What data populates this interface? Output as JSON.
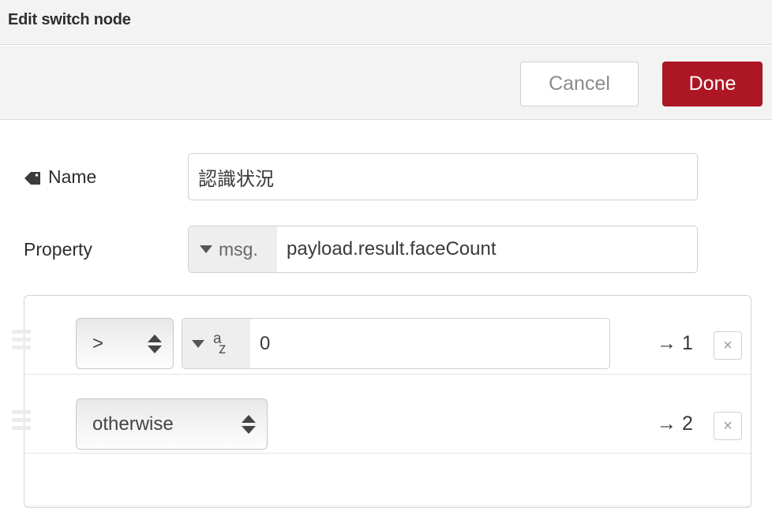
{
  "header": {
    "title": "Edit switch node"
  },
  "toolbar": {
    "cancel_label": "Cancel",
    "done_label": "Done",
    "done_color": "#ad1625"
  },
  "form": {
    "name": {
      "label": "Name",
      "icon": "tag-icon",
      "value": "認識状況"
    },
    "property": {
      "label": "Property",
      "type_prefix": "msg.",
      "value": "payload.result.faceCount"
    }
  },
  "rules": [
    {
      "operator": ">",
      "value_type_icon": "az-icon",
      "value": "0",
      "output": "→ 1",
      "delete_label": "×"
    },
    {
      "operator": "otherwise",
      "output": "→ 2",
      "delete_label": "×"
    }
  ]
}
